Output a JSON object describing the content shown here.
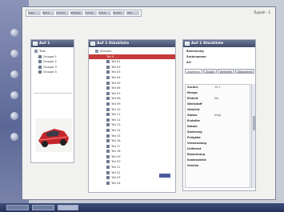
{
  "colors": {
    "selection": "#c63a3a",
    "titlebar": "#4a5573",
    "desktop": "#c8ccd6"
  },
  "topright": {
    "text": "Tupanh · 1"
  },
  "menu": [
    "Datei",
    "Bearb.",
    "Ansicht",
    "Einfügen",
    "Format",
    "Extras",
    "Fenster",
    "Hilfe"
  ],
  "panel_left": {
    "title": "Auf 1",
    "tree": [
      "Teile",
      "Gruppe 1",
      "Gruppe 2",
      "Gruppe 3",
      "Gruppe 4"
    ]
  },
  "panel_mid": {
    "title": "Auf 1 Stückliste",
    "root": "Struktur",
    "selected": "Teil 0 ...",
    "items": [
      "Teil 01",
      "Teil 02",
      "Teil 03",
      "Teil 04",
      "Teil 05",
      "Teil 06",
      "Teil 07",
      "Teil 08",
      "Teil 09",
      "Teil 10",
      "Teil 11",
      "Teil 12",
      "Teil 13",
      "Teil 14",
      "Teil 15",
      "Teil 16",
      "Teil 17",
      "Teil 18",
      "Teil 19",
      "Teil 20",
      "Teil 21",
      "Teil 22",
      "Teil 23",
      "Teil 24"
    ]
  },
  "panel_right": {
    "title": "Auf 1 Stückliste",
    "fields": [
      {
        "k": "Benennung",
        "v": ""
      },
      {
        "k": "Sachnummer",
        "v": ""
      },
      {
        "k": "Art",
        "v": ""
      }
    ],
    "tabs": [
      "Allgemein",
      "Zusatz",
      "Varianten",
      "Dokumente"
    ],
    "props": [
      {
        "k": "Sachnr.",
        "v": "12.1"
      },
      {
        "k": "Menge",
        "v": ""
      },
      {
        "k": "Einheit",
        "v": "Stk"
      },
      {
        "k": "Werkstoff",
        "v": ""
      },
      {
        "k": "Gewicht",
        "v": ""
      },
      {
        "k": "Status",
        "v": "freig."
      },
      {
        "k": "Ersteller",
        "v": ""
      },
      {
        "k": "Datum",
        "v": ""
      },
      {
        "k": "Änderung",
        "v": ""
      },
      {
        "k": "Freigabe",
        "v": ""
      },
      {
        "k": "Verwendung",
        "v": ""
      },
      {
        "k": "Lieferant",
        "v": ""
      },
      {
        "k": "Bemerkung",
        "v": ""
      },
      {
        "k": "Kostenstelle",
        "v": ""
      },
      {
        "k": "Version",
        "v": ""
      }
    ]
  }
}
